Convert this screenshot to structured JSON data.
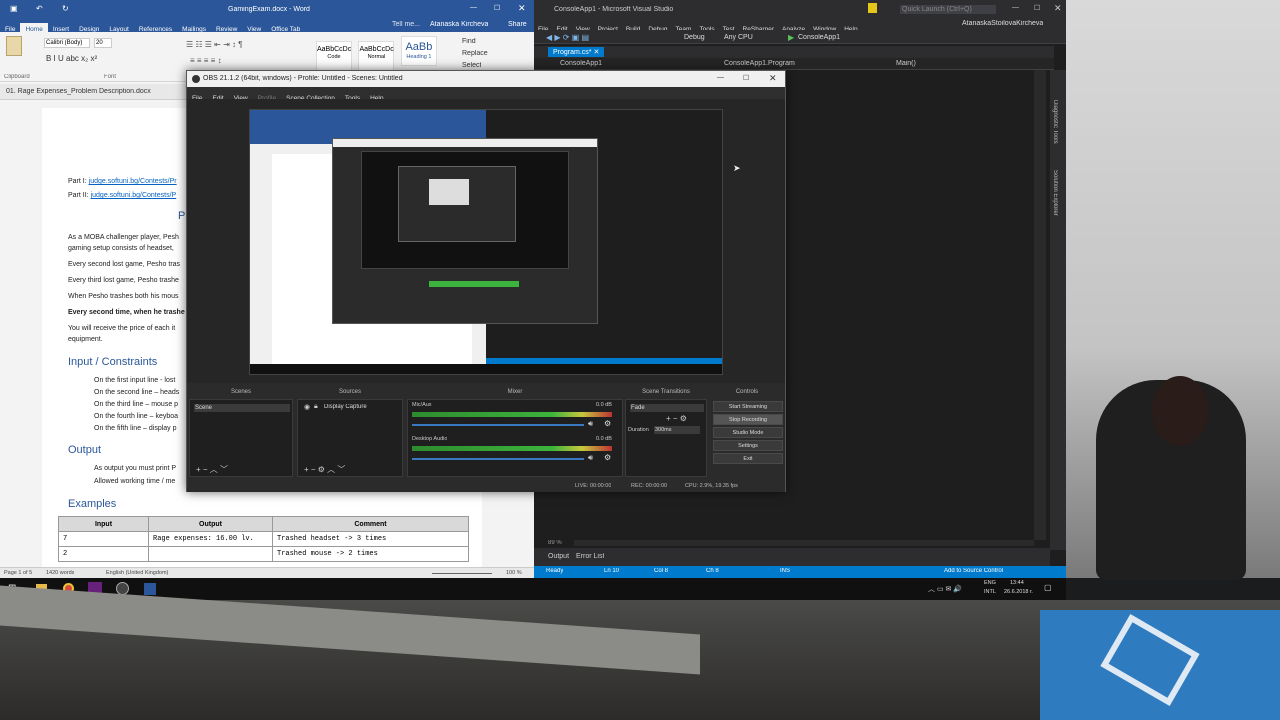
{
  "word": {
    "title": "GamingExam.docx - Word",
    "user": "Atanaska Kircheva",
    "share": "Share",
    "tell_me": "Tell me...",
    "tabs": [
      "File",
      "Home",
      "Insert",
      "Design",
      "Layout",
      "References",
      "Mailings",
      "Review",
      "View",
      "Office Tab"
    ],
    "font": "Calibri (Body)",
    "font_size": "20",
    "styles": [
      "AaBbCcDc",
      "AaBbCcDc",
      "AaBb"
    ],
    "style_names": [
      "Code",
      "Normal",
      "Heading 1"
    ],
    "editing": [
      "Find",
      "Replace",
      "Select"
    ],
    "groups": [
      "Clipboard",
      "Font"
    ],
    "doc_tab": "01. Rage Expenses_Problem Description.docx",
    "doc": {
      "part1_label": "Part I:",
      "part1_link": "judge.softuni.bg/Contests/Pr",
      "part2_label": "Part II:",
      "part2_link": "judge.softuni.bg/Contests/P",
      "p_heading_fragment": "P",
      "lines": [
        "As a MOBA challenger player, Pesh",
        "gaming setup consists of headset, ",
        "Every second lost game, Pesho tras",
        "Every third lost game, Pesho trashe",
        "When Pesho trashes both his mous",
        "Every second time, when he trashe",
        "You will receive the price of each it",
        "equipment."
      ],
      "input_heading": "Input / Constraints",
      "input_items": [
        "On the first input line - lost",
        "On the second line – heads",
        "On the third line – mouse p",
        "On the fourth line – keyboa",
        "On the fifth line – display p"
      ],
      "output_heading": "Output",
      "output_items": [
        "As output you must print P",
        "Allowed working time / me"
      ],
      "examples_heading": "Examples",
      "table_headers": [
        "Input",
        "Output",
        "Comment"
      ],
      "table_rows": [
        [
          "7",
          "Rage expenses: 16.00 lv.",
          "Trashed headset -> 3 times"
        ],
        [
          "2",
          "",
          "Trashed mouse -> 2 times"
        ]
      ]
    },
    "status": {
      "page": "Page 1 of 5",
      "words": "1420 words",
      "lang": "English (United Kingdom)",
      "zoom": "100 %"
    }
  },
  "vs": {
    "title": "ConsoleApp1 - Microsoft Visual Studio",
    "quick_launch": "Quick Launch (Ctrl+Q)",
    "user": "AtanaskaStoilovaKircheva",
    "menu": [
      "File",
      "Edit",
      "View",
      "Project",
      "Build",
      "Debug",
      "Team",
      "Tools",
      "Test",
      "ReSharper",
      "Analyze",
      "Window",
      "Help"
    ],
    "config": "Debug",
    "platform": "Any CPU",
    "start": "ConsoleApp1",
    "tab": "Program.cs*",
    "nav": [
      "ConsoleApp1",
      "ConsoleApp1.Program",
      "Main()"
    ],
    "side_tabs": [
      "Diagnostic Tools",
      "Solution Explorer"
    ],
    "zoom": "89 %",
    "bottom_tabs": [
      "Output",
      "Error List"
    ],
    "status": {
      "ready": "Ready",
      "ln": "Ln 10",
      "col": "Col 8",
      "ch": "Ch 8",
      "ins": "INS",
      "source_control": "Add to Source Control"
    }
  },
  "obs": {
    "title": "OBS 21.1.2 (64bit, windows) - Profile: Untitled - Scenes: Untitled",
    "menu": [
      "File",
      "Edit",
      "View",
      "Profile",
      "Scene Collection",
      "Tools",
      "Help"
    ],
    "docks": [
      "Scenes",
      "Sources",
      "Mixer",
      "Scene Transitions",
      "Controls"
    ],
    "scene": "Scene",
    "source": "Display Capture",
    "mixer": [
      {
        "name": "Mic/Aux",
        "db": "0.0 dB"
      },
      {
        "name": "Desktop Audio",
        "db": "0.0 dB"
      }
    ],
    "transition": "Fade",
    "duration_label": "Duration",
    "duration_value": "300ms",
    "controls": [
      "Start Streaming",
      "Stop Recording",
      "Studio Mode",
      "Settings",
      "Exit"
    ],
    "status": {
      "live": "LIVE: 00:00:00",
      "rec": "REC: 00:00:00",
      "cpu": "CPU: 2.9%, 19.35 fps"
    }
  },
  "taskbar": {
    "lang": "ENG",
    "lang2": "INTL",
    "time": "13:44",
    "date": "26.6.2018 г."
  }
}
